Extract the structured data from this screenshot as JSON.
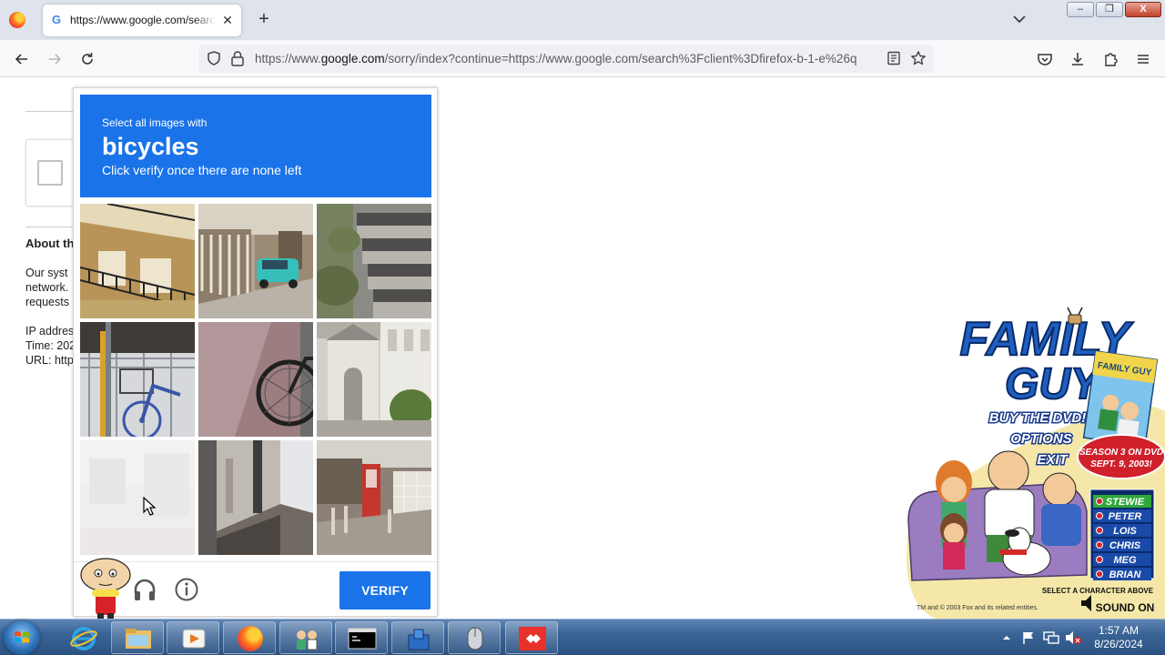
{
  "browser": {
    "tab_title": "https://www.google.com/search",
    "url_prefix": "https://www.",
    "url_host": "google.com",
    "url_rest": "/sorry/index?continue=https://www.google.com/search%3Fclient%3Dfirefox-b-1-e%26q",
    "window_buttons": [
      "–",
      "❐",
      "X"
    ]
  },
  "background_page": {
    "heading": "About th",
    "lines": [
      "Our syst",
      "network.",
      "requests"
    ],
    "details": [
      "IP addres",
      "Time: 202",
      "URL: http"
    ]
  },
  "captcha": {
    "instruction": "Select all images with",
    "target": "bicycles",
    "subtext": "Click verify once there are none left",
    "verify_label": "VERIFY",
    "tiles": [
      "building-balcony",
      "street-teal-car",
      "stone-steps",
      "bicycle-basket",
      "bicycle-wheel",
      "white-house",
      "faded-tile",
      "building-corner",
      "red-phone-booth-street"
    ]
  },
  "overlay": {
    "title_line1": "FAMILY",
    "title_line2": "GUY",
    "menu": [
      "BUY THE DVD!",
      "OPTIONS",
      "EXIT"
    ],
    "dvd_cover": "FAMILY GUY",
    "season": "SEASON 3 ON DVD",
    "season_date": "SEPT. 9, 2003!",
    "characters": [
      "STEWIE",
      "PETER",
      "LOIS",
      "CHRIS",
      "MEG",
      "BRIAN"
    ],
    "select_hint": "SELECT A CHARACTER ABOVE",
    "copyright": "TM and © 2003 Fox and its related entities.",
    "sound": "SOUND ON"
  },
  "taskbar": {
    "time": "1:57 AM",
    "date": "8/26/2024"
  },
  "colors": {
    "captcha_blue": "#1a73e8",
    "taskbar": "#3a6496"
  }
}
